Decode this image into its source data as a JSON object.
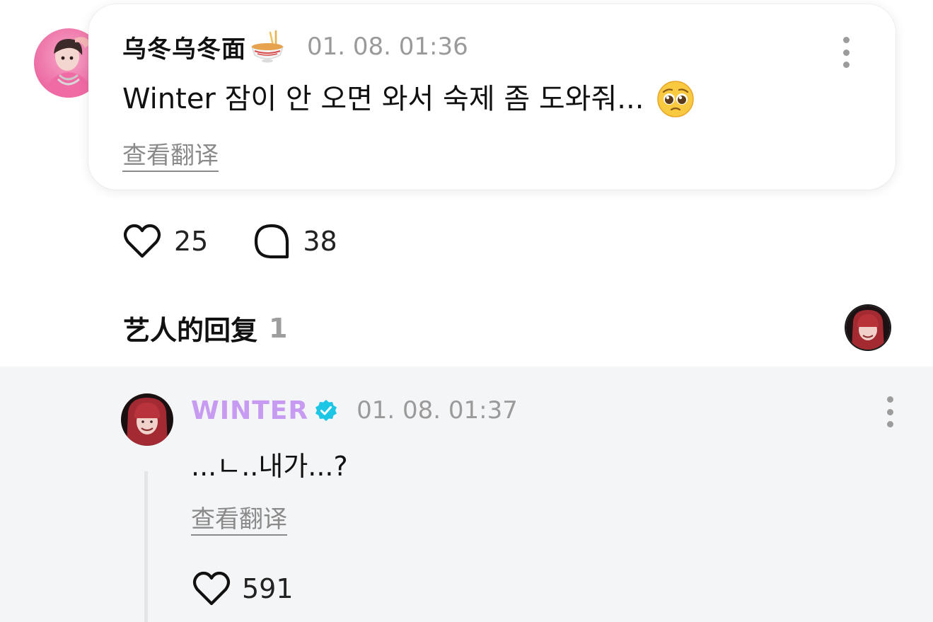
{
  "post": {
    "author_name": "乌冬乌冬面",
    "author_emoji_icon": "noodle-bowl-emoji",
    "timestamp": "01. 08. 01:36",
    "body_text": "Winter 잠이 안 오면 와서 숙제 좀 도와줘...",
    "body_emoji_icon": "pleading-face-emoji",
    "translate_label": "查看翻译",
    "like_count": "25",
    "comment_count": "38"
  },
  "artist_reply_section": {
    "title": "艺人的回复",
    "count": "1"
  },
  "reply": {
    "author_name": "WINTER",
    "verified_icon": "verified-badge-icon",
    "timestamp": "01. 08. 01:37",
    "body_text": "...ㄴ..내가...?",
    "translate_label": "查看翻译",
    "like_count": "591"
  },
  "colors": {
    "artist_name": "#c79bf2",
    "verified_badge": "#1ec6e6",
    "muted_text": "#9a9a9a",
    "reply_background": "#f4f5f7"
  }
}
